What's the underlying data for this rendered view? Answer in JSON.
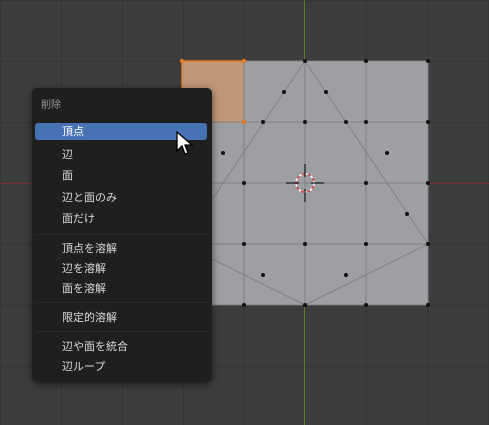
{
  "menu": {
    "title": "削除",
    "items": [
      {
        "label": "頂点",
        "active": true
      },
      {
        "label": "辺"
      },
      {
        "label": "面"
      },
      {
        "label": "辺と面のみ"
      },
      {
        "label": "面だけ"
      },
      {
        "label": "頂点を溶解"
      },
      {
        "label": "辺を溶解"
      },
      {
        "label": "面を溶解"
      },
      {
        "label": "限定的溶解"
      },
      {
        "label": "辺や面を統合"
      },
      {
        "label": "辺ループ"
      }
    ]
  },
  "colors": {
    "menu_bg": "#1f1f1f",
    "highlight": "#4772b3",
    "mesh_face": "#9e9fa3",
    "selected_vertex": "#e07c2a",
    "axis_x": "#7a2f36",
    "axis_y": "#5e7f2c"
  },
  "icons": {
    "cursor": "arrow-cursor-icon",
    "pivot": "3d-cursor-icon"
  }
}
